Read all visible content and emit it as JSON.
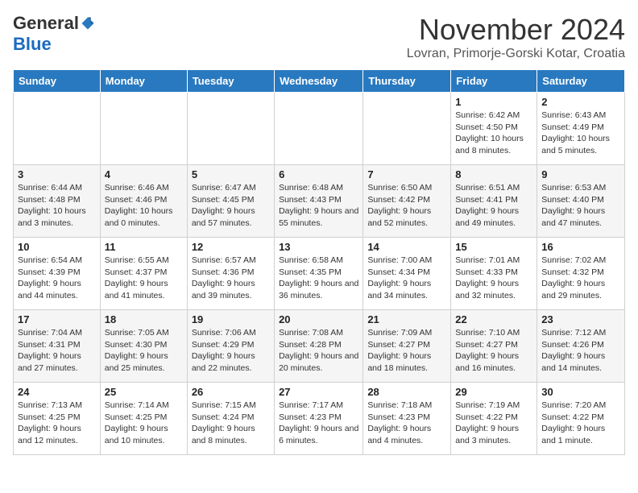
{
  "header": {
    "logo_general": "General",
    "logo_blue": "Blue",
    "month_title": "November 2024",
    "subtitle": "Lovran, Primorje-Gorski Kotar, Croatia"
  },
  "weekdays": [
    "Sunday",
    "Monday",
    "Tuesday",
    "Wednesday",
    "Thursday",
    "Friday",
    "Saturday"
  ],
  "weeks": [
    [
      {
        "day": "",
        "info": ""
      },
      {
        "day": "",
        "info": ""
      },
      {
        "day": "",
        "info": ""
      },
      {
        "day": "",
        "info": ""
      },
      {
        "day": "",
        "info": ""
      },
      {
        "day": "1",
        "info": "Sunrise: 6:42 AM\nSunset: 4:50 PM\nDaylight: 10 hours and 8 minutes."
      },
      {
        "day": "2",
        "info": "Sunrise: 6:43 AM\nSunset: 4:49 PM\nDaylight: 10 hours and 5 minutes."
      }
    ],
    [
      {
        "day": "3",
        "info": "Sunrise: 6:44 AM\nSunset: 4:48 PM\nDaylight: 10 hours and 3 minutes."
      },
      {
        "day": "4",
        "info": "Sunrise: 6:46 AM\nSunset: 4:46 PM\nDaylight: 10 hours and 0 minutes."
      },
      {
        "day": "5",
        "info": "Sunrise: 6:47 AM\nSunset: 4:45 PM\nDaylight: 9 hours and 57 minutes."
      },
      {
        "day": "6",
        "info": "Sunrise: 6:48 AM\nSunset: 4:43 PM\nDaylight: 9 hours and 55 minutes."
      },
      {
        "day": "7",
        "info": "Sunrise: 6:50 AM\nSunset: 4:42 PM\nDaylight: 9 hours and 52 minutes."
      },
      {
        "day": "8",
        "info": "Sunrise: 6:51 AM\nSunset: 4:41 PM\nDaylight: 9 hours and 49 minutes."
      },
      {
        "day": "9",
        "info": "Sunrise: 6:53 AM\nSunset: 4:40 PM\nDaylight: 9 hours and 47 minutes."
      }
    ],
    [
      {
        "day": "10",
        "info": "Sunrise: 6:54 AM\nSunset: 4:39 PM\nDaylight: 9 hours and 44 minutes."
      },
      {
        "day": "11",
        "info": "Sunrise: 6:55 AM\nSunset: 4:37 PM\nDaylight: 9 hours and 41 minutes."
      },
      {
        "day": "12",
        "info": "Sunrise: 6:57 AM\nSunset: 4:36 PM\nDaylight: 9 hours and 39 minutes."
      },
      {
        "day": "13",
        "info": "Sunrise: 6:58 AM\nSunset: 4:35 PM\nDaylight: 9 hours and 36 minutes."
      },
      {
        "day": "14",
        "info": "Sunrise: 7:00 AM\nSunset: 4:34 PM\nDaylight: 9 hours and 34 minutes."
      },
      {
        "day": "15",
        "info": "Sunrise: 7:01 AM\nSunset: 4:33 PM\nDaylight: 9 hours and 32 minutes."
      },
      {
        "day": "16",
        "info": "Sunrise: 7:02 AM\nSunset: 4:32 PM\nDaylight: 9 hours and 29 minutes."
      }
    ],
    [
      {
        "day": "17",
        "info": "Sunrise: 7:04 AM\nSunset: 4:31 PM\nDaylight: 9 hours and 27 minutes."
      },
      {
        "day": "18",
        "info": "Sunrise: 7:05 AM\nSunset: 4:30 PM\nDaylight: 9 hours and 25 minutes."
      },
      {
        "day": "19",
        "info": "Sunrise: 7:06 AM\nSunset: 4:29 PM\nDaylight: 9 hours and 22 minutes."
      },
      {
        "day": "20",
        "info": "Sunrise: 7:08 AM\nSunset: 4:28 PM\nDaylight: 9 hours and 20 minutes."
      },
      {
        "day": "21",
        "info": "Sunrise: 7:09 AM\nSunset: 4:27 PM\nDaylight: 9 hours and 18 minutes."
      },
      {
        "day": "22",
        "info": "Sunrise: 7:10 AM\nSunset: 4:27 PM\nDaylight: 9 hours and 16 minutes."
      },
      {
        "day": "23",
        "info": "Sunrise: 7:12 AM\nSunset: 4:26 PM\nDaylight: 9 hours and 14 minutes."
      }
    ],
    [
      {
        "day": "24",
        "info": "Sunrise: 7:13 AM\nSunset: 4:25 PM\nDaylight: 9 hours and 12 minutes."
      },
      {
        "day": "25",
        "info": "Sunrise: 7:14 AM\nSunset: 4:25 PM\nDaylight: 9 hours and 10 minutes."
      },
      {
        "day": "26",
        "info": "Sunrise: 7:15 AM\nSunset: 4:24 PM\nDaylight: 9 hours and 8 minutes."
      },
      {
        "day": "27",
        "info": "Sunrise: 7:17 AM\nSunset: 4:23 PM\nDaylight: 9 hours and 6 minutes."
      },
      {
        "day": "28",
        "info": "Sunrise: 7:18 AM\nSunset: 4:23 PM\nDaylight: 9 hours and 4 minutes."
      },
      {
        "day": "29",
        "info": "Sunrise: 7:19 AM\nSunset: 4:22 PM\nDaylight: 9 hours and 3 minutes."
      },
      {
        "day": "30",
        "info": "Sunrise: 7:20 AM\nSunset: 4:22 PM\nDaylight: 9 hours and 1 minute."
      }
    ]
  ]
}
